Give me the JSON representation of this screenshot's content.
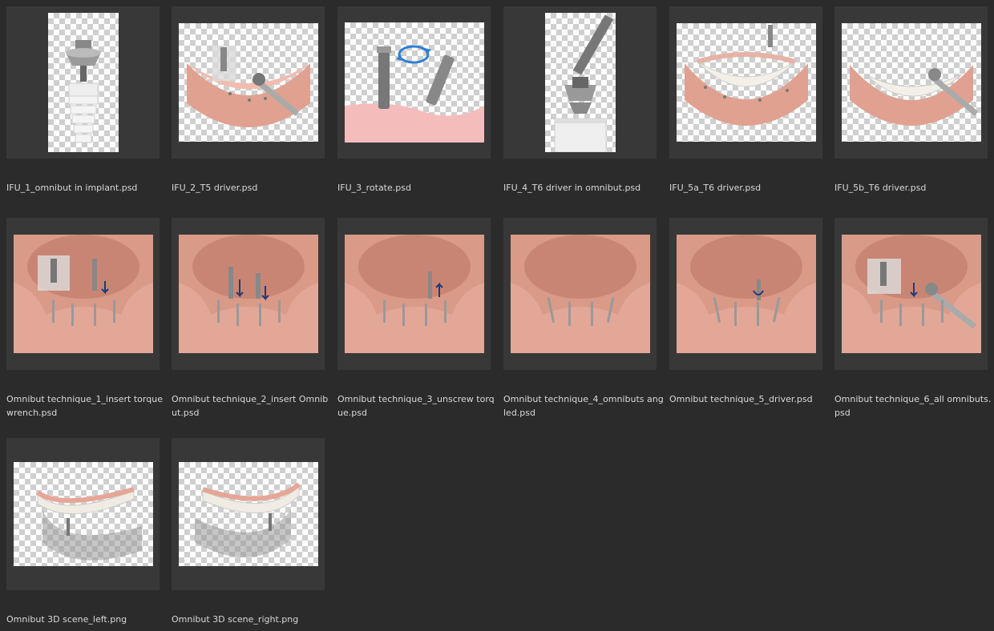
{
  "files": [
    {
      "name": "IFU_1_omnibut in implant.psd",
      "icon": "implant-omnibut-thumbnail"
    },
    {
      "name": "IFU_2_T5 driver.psd",
      "icon": "t5-driver-thumbnail"
    },
    {
      "name": "IFU_3_rotate.psd",
      "icon": "rotate-thumbnail"
    },
    {
      "name": "IFU_4_T6 driver in omnibut.psd",
      "icon": "t6-driver-omnibut-thumbnail"
    },
    {
      "name": "IFU_5a_T6 driver.psd",
      "icon": "t6-driver-denture-thumbnail"
    },
    {
      "name": "IFU_5b_T6 driver.psd",
      "icon": "t6-driver-wrench-thumbnail"
    },
    {
      "name": "Omnibut technique_1_insert torque wrench.psd",
      "icon": "technique-1-thumbnail"
    },
    {
      "name": "Omnibut technique_2_insert Omnibut.psd",
      "icon": "technique-2-thumbnail"
    },
    {
      "name": "Omnibut technique_3_unscrew torque.psd",
      "icon": "technique-3-thumbnail"
    },
    {
      "name": "Omnibut technique_4_omnibuts angled.psd",
      "icon": "technique-4-thumbnail"
    },
    {
      "name": "Omnibut technique_5_driver.psd",
      "icon": "technique-5-thumbnail"
    },
    {
      "name": "Omnibut technique_6_all omnibuts.psd",
      "icon": "technique-6-thumbnail"
    },
    {
      "name": "Omnibut 3D scene_left.png",
      "icon": "3d-scene-left-thumbnail"
    },
    {
      "name": "Omnibut 3D scene_right.png",
      "icon": "3d-scene-right-thumbnail"
    }
  ],
  "colors": {
    "background": "#2b2b2b",
    "tile": "#383838",
    "caption_text": "#d8d8d8",
    "gum": "#e8a796",
    "arrow": "#1f3a7a",
    "rotate_arrow": "#2f7fd6"
  }
}
